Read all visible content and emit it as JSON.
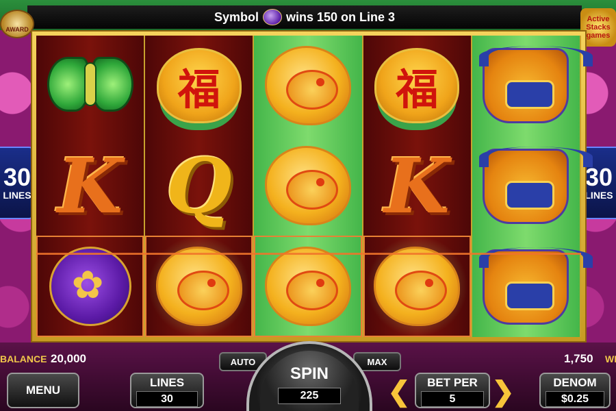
{
  "top_message": {
    "prefix": "Symbol",
    "suffix": "wins 150 on Line 3",
    "symbol_icon": "purple-pouch-icon"
  },
  "award_logo": {
    "text": "AWARD"
  },
  "right_logo": {
    "line1": "Active",
    "line2": "Stacks",
    "line3": "games"
  },
  "side_badges": {
    "left": {
      "number": "30",
      "label": "LINES"
    },
    "right": {
      "number": "30",
      "label": "LINES"
    }
  },
  "reels": [
    {
      "bg": "red",
      "symbols": [
        "butterfly",
        "K",
        "purple-pouch"
      ]
    },
    {
      "bg": "red",
      "symbols": [
        "fu",
        "Q",
        "monkey"
      ]
    },
    {
      "bg": "green",
      "symbols": [
        "monkey",
        "monkey",
        "monkey"
      ]
    },
    {
      "bg": "red",
      "symbols": [
        "fu",
        "K",
        "monkey"
      ]
    },
    {
      "bg": "green",
      "symbols": [
        "ox",
        "ox",
        "ox"
      ]
    }
  ],
  "fu_character": "福",
  "letters": {
    "k": "K",
    "q": "Q"
  },
  "bottom": {
    "balance_label": "BALANCE",
    "balance_value": "20,000",
    "win_value": "1,750",
    "win_label": "WIN",
    "auto_label": "AUTO",
    "max_label": "MAX",
    "menu_label": "MENU",
    "lines_label": "LINES",
    "lines_value": "30",
    "spin_label": "SPIN",
    "spin_value": "225",
    "bet_per_label": "BET PER",
    "bet_per_value": "5",
    "denom_label": "DENOM",
    "denom_value": "$0.25"
  },
  "colors": {
    "frame_gold": "#f5d35c",
    "reel_red": "#7a120b",
    "reel_green": "#7edb6d",
    "win_line": "#f0742a",
    "lines_badge": "#1a2e8a"
  }
}
